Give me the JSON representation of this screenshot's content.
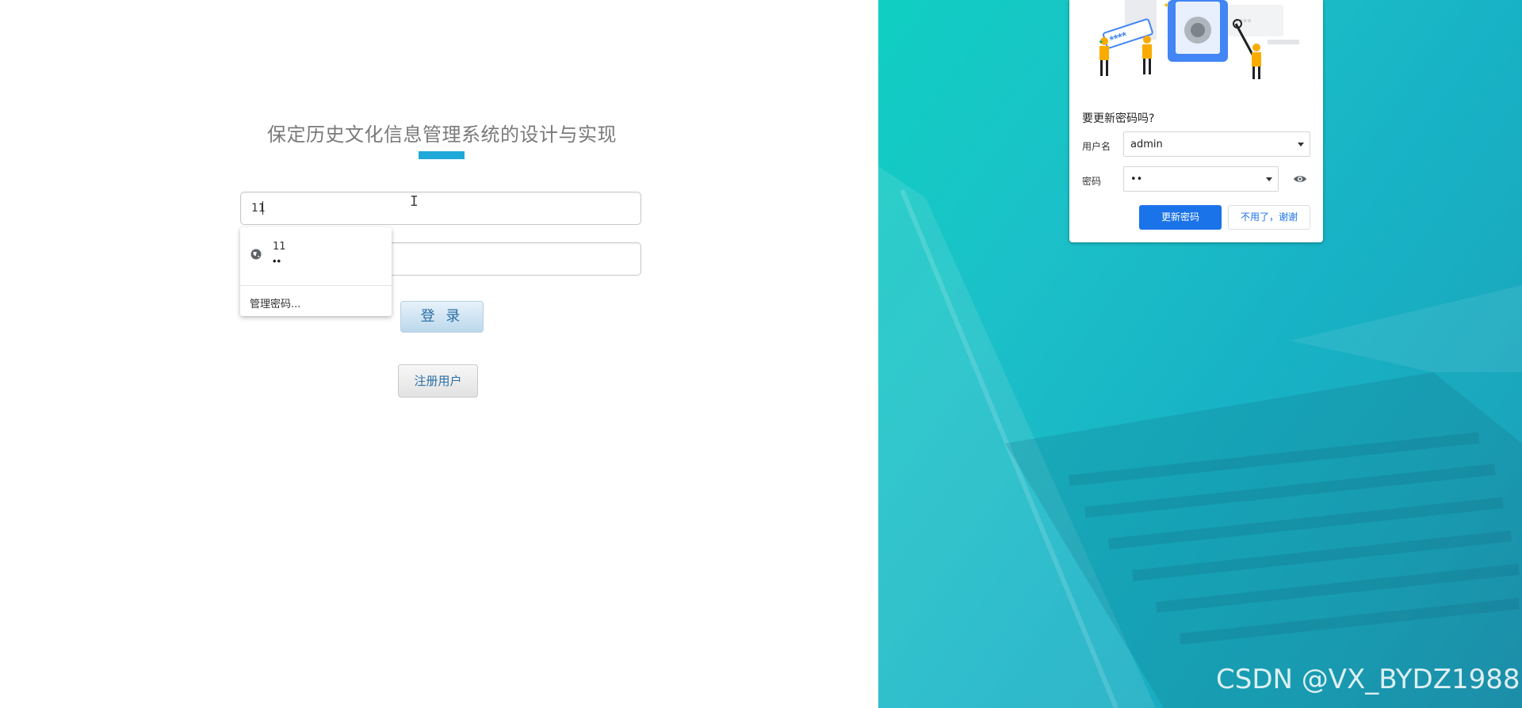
{
  "page": {
    "title": "保定历史文化信息管理系统的设计与实现"
  },
  "login_form": {
    "username_value": "11",
    "password_value": "",
    "login_label": "登 录",
    "register_label": "注册用户"
  },
  "autofill_dropdown": {
    "suggestion_user": "11",
    "suggestion_pass": "••",
    "manage_label": "管理密码..."
  },
  "password_popup": {
    "title": "要更新密码吗?",
    "username_label": "用户名",
    "username_value": "admin",
    "password_label": "密码",
    "password_value": "••",
    "update_label": "更新密码",
    "decline_label": "不用了，谢谢",
    "accent_color": "#1a73e8"
  },
  "watermark": "CSDN @VX_BYDZ1988",
  "colors": {
    "title_accent": "#1fa9d8",
    "background_teal": "#18b3c6"
  }
}
